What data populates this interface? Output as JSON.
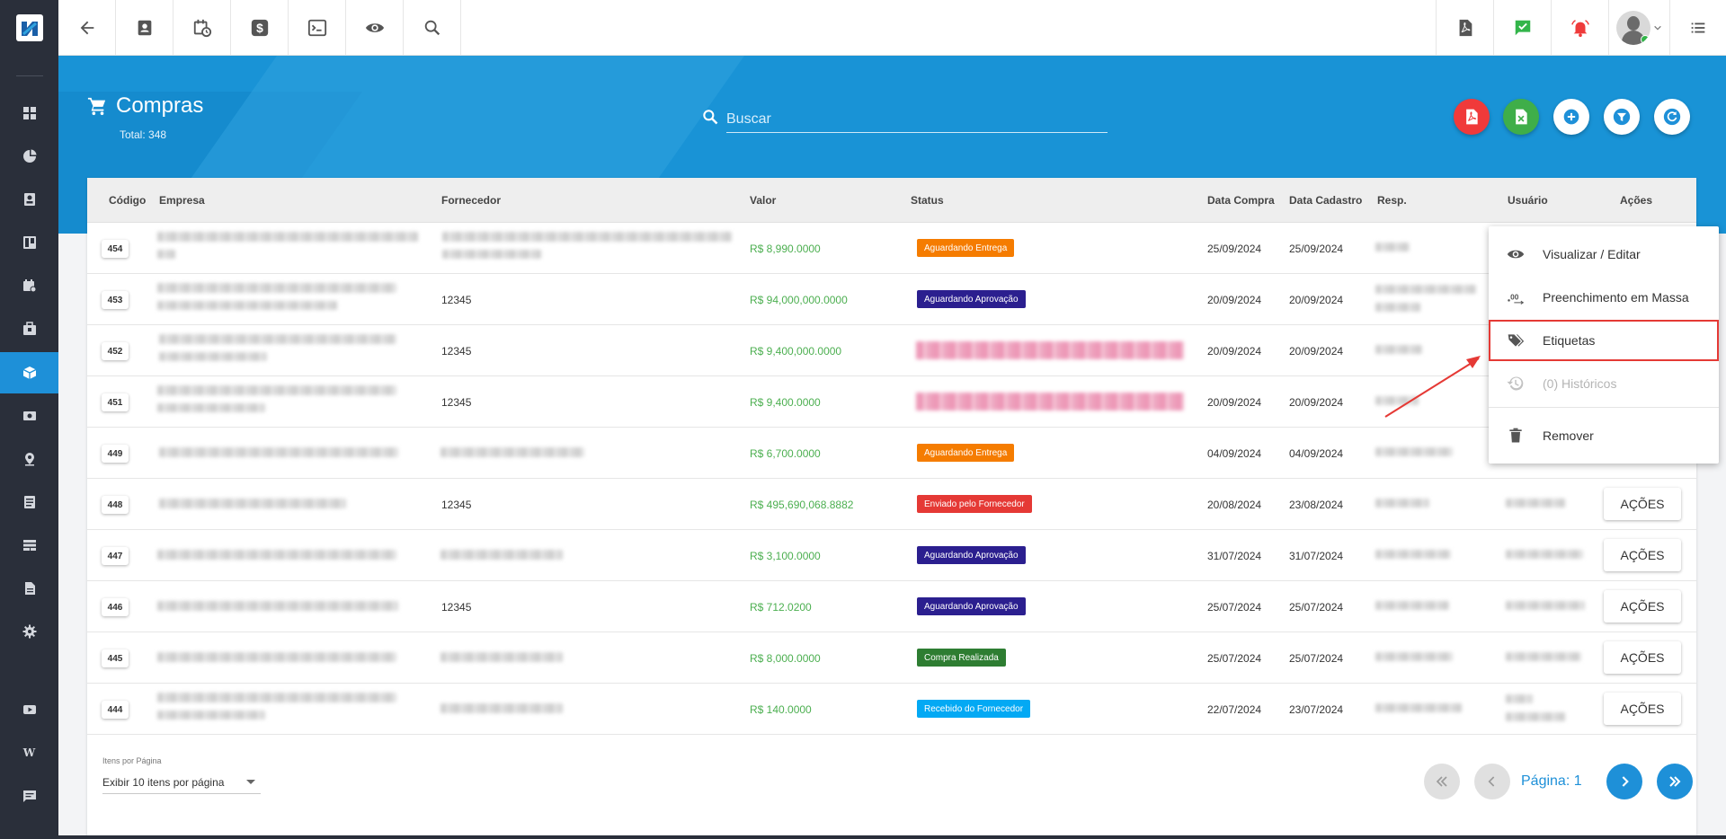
{
  "topbar": {
    "icons": [
      "back-arrow-icon",
      "contact-card-icon",
      "calendar-clock-icon",
      "dollar-icon",
      "terminal-icon",
      "eye-icon",
      "search-icon"
    ],
    "right_icons": [
      "pdf-file-icon",
      "chat-check-icon",
      "alarm-bell-icon",
      "user-avatar",
      "menu-list-icon"
    ],
    "colors": {
      "chat": "#33b54a",
      "alarm": "#ef3b3b"
    }
  },
  "sidebar": {
    "items": [
      "dashboard-icon",
      "pie-chart-icon",
      "contacts-icon",
      "kanban-icon",
      "calendar-icon",
      "briefcase-icon",
      "package-icon",
      "money-icon",
      "location-icon",
      "list-icon",
      "storage-icon",
      "document-icon",
      "settings-icon",
      "video-icon",
      "wiki-icon",
      "chat-icon"
    ],
    "wiki_letter": "W",
    "active": "package-icon"
  },
  "header": {
    "title": "Compras",
    "total": "Total: 348",
    "search_placeholder": "Buscar",
    "colors": {
      "banner": "#1993d6",
      "pdf": "#f03a3a",
      "excel": "#3fae49"
    }
  },
  "table": {
    "columns": [
      "Código",
      "Empresa",
      "Fornecedor",
      "Valor",
      "Status",
      "Data Compra",
      "Data Cadastro",
      "Resp.",
      "Usuário",
      "Ações"
    ],
    "action_label": "AÇÕES",
    "rows": [
      {
        "code": "454",
        "fornecedor": "",
        "valor": "R$ 8,990.0000",
        "status": "Aguardando Entrega",
        "status_color": "#f57c00",
        "data_compra": "25/09/2024",
        "data_cadastro": "25/09/2024"
      },
      {
        "code": "453",
        "fornecedor": "12345",
        "valor": "R$ 94,000,000.0000",
        "status": "Aguardando Aprovação",
        "status_color": "#2b1f8f",
        "data_compra": "20/09/2024",
        "data_cadastro": "20/09/2024"
      },
      {
        "code": "452",
        "fornecedor": "12345",
        "valor": "R$ 9,400,000.0000",
        "status": "",
        "status_color": "#e97fa6",
        "data_compra": "20/09/2024",
        "data_cadastro": "20/09/2024"
      },
      {
        "code": "451",
        "fornecedor": "12345",
        "valor": "R$ 9,400.0000",
        "status": "",
        "status_color": "#e97fa6",
        "data_compra": "20/09/2024",
        "data_cadastro": "20/09/2024"
      },
      {
        "code": "449",
        "fornecedor": "",
        "valor": "R$ 6,700.0000",
        "status": "Aguardando Entrega",
        "status_color": "#f57c00",
        "data_compra": "04/09/2024",
        "data_cadastro": "04/09/2024"
      },
      {
        "code": "448",
        "fornecedor": "12345",
        "valor": "R$ 495,690,068.8882",
        "status": "Enviado pelo Fornecedor",
        "status_color": "#e53935",
        "data_compra": "20/08/2024",
        "data_cadastro": "23/08/2024"
      },
      {
        "code": "447",
        "fornecedor": "",
        "valor": "R$ 3,100.0000",
        "status": "Aguardando Aprovação",
        "status_color": "#2b1f8f",
        "data_compra": "31/07/2024",
        "data_cadastro": "31/07/2024"
      },
      {
        "code": "446",
        "fornecedor": "12345",
        "valor": "R$ 712.0200",
        "status": "Aguardando Aprovação",
        "status_color": "#2b1f8f",
        "data_compra": "25/07/2024",
        "data_cadastro": "25/07/2024"
      },
      {
        "code": "445",
        "fornecedor": "",
        "valor": "R$ 8,000.0000",
        "status": "Compra Realizada",
        "status_color": "#2e7d32",
        "data_compra": "25/07/2024",
        "data_cadastro": "25/07/2024"
      },
      {
        "code": "444",
        "fornecedor": "",
        "valor": "R$ 140.0000",
        "status": "Recebido do Fornecedor",
        "status_color": "#03a9f4",
        "data_compra": "22/07/2024",
        "data_cadastro": "23/07/2024"
      }
    ]
  },
  "pagination": {
    "per_page_label": "Itens por Página",
    "per_page_value": "Exibir 10 itens por página",
    "page_text": "Página: 1"
  },
  "menu": {
    "items": [
      {
        "label": "Visualizar / Editar",
        "icon": "eye-icon"
      },
      {
        "label": "Preenchimento em Massa",
        "icon": "decimal-icon"
      },
      {
        "label": "Etiquetas",
        "icon": "tags-icon"
      },
      {
        "label": "(0) Históricos",
        "icon": "history-icon"
      },
      {
        "label": "Remover",
        "icon": "trash-icon"
      }
    ]
  }
}
